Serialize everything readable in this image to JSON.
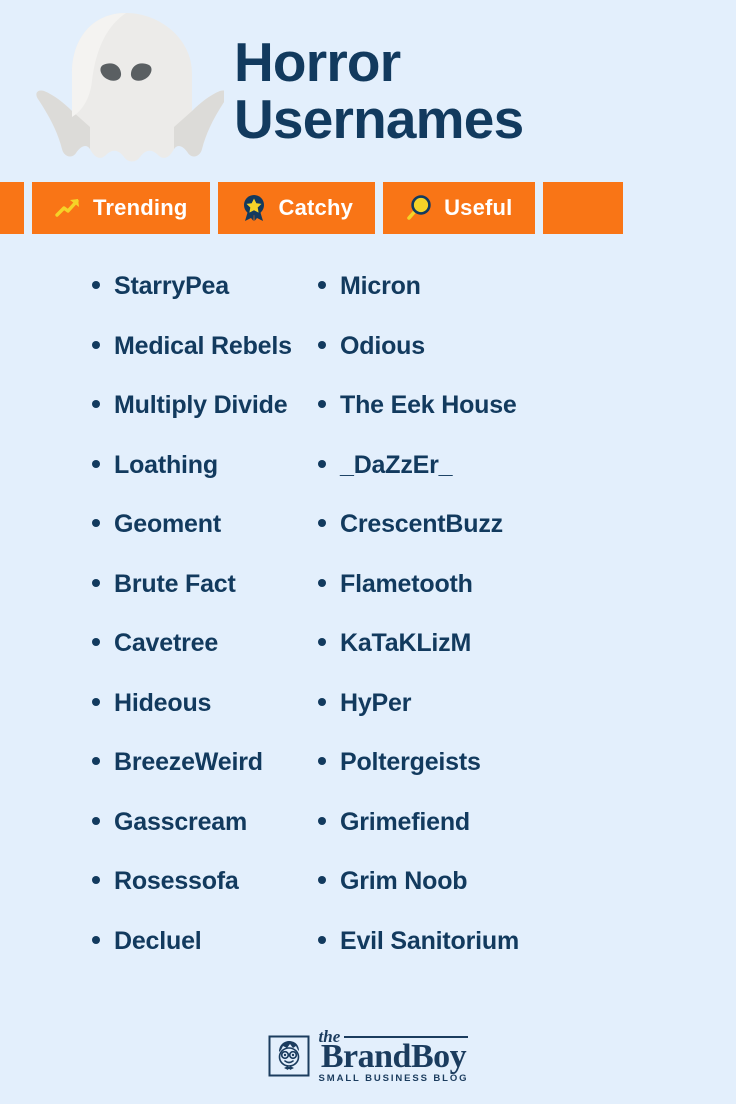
{
  "theme": {
    "background": "#e3effc",
    "accent_orange": "#f97516",
    "navy": "#123a5e",
    "badge_text": "#ffffff",
    "icon_yellow": "#f5d328",
    "ghost_body": "#e9e9e7",
    "ghost_shadow": "#d9d9d6",
    "ghost_eye": "#5a5f62"
  },
  "header": {
    "title_line_1": "Horror",
    "title_line_2": "Usernames",
    "ghost_icon": "ghost-icon"
  },
  "badges": [
    {
      "label": "Trending",
      "icon": "trending-up-icon"
    },
    {
      "label": "Catchy",
      "icon": "award-medal-icon"
    },
    {
      "label": "Useful",
      "icon": "magnifying-glass-icon"
    }
  ],
  "lists": {
    "left_column": [
      "StarryPea",
      "Medical Rebels",
      "Multiply Divide",
      "Loathing",
      "Geoment",
      "Brute Fact",
      "Cavetree",
      "Hideous",
      "BreezeWeird",
      "Gasscream",
      "Rosessofa",
      "Decluel"
    ],
    "right_column": [
      "Micron",
      "Odious",
      "The Eek House",
      "_DaZzEr_",
      "CrescentBuzz",
      "Flametooth",
      "KaTaKLizM",
      "HyPer",
      "Poltergeists",
      "Grimefiend",
      "Grim Noob",
      "Evil Sanitorium"
    ]
  },
  "footer": {
    "logo_mark": "brandboy-face-icon",
    "logo_the": "the",
    "logo_name": "BrandBoy",
    "logo_tagline": "SMALL BUSINESS BLOG"
  }
}
